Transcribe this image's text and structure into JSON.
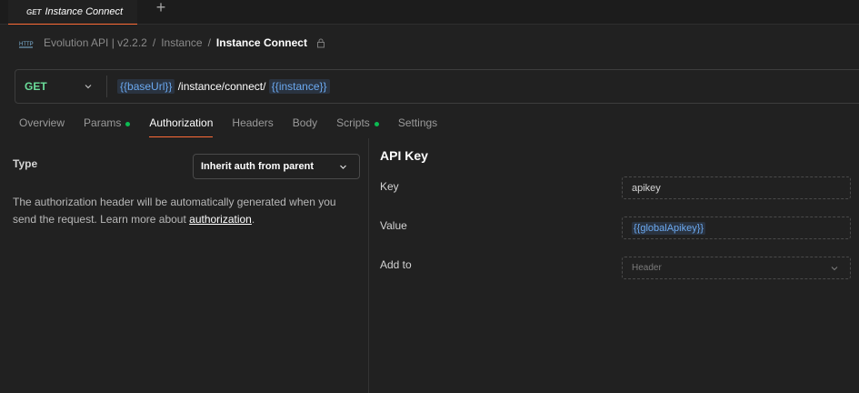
{
  "tab": {
    "method": "GET",
    "name": "Instance Connect",
    "new_tab": "+"
  },
  "breadcrumb": {
    "collection": "Evolution API | v2.2.2",
    "folder": "Instance",
    "separator": "/",
    "current": "Instance Connect"
  },
  "request": {
    "method": "GET",
    "url_var1": "{{baseUrl}}",
    "url_path": " /instance/connect/ ",
    "url_var2": "{{instance}}"
  },
  "tabs": [
    {
      "label": "Overview",
      "dot": false
    },
    {
      "label": "Params",
      "dot": true
    },
    {
      "label": "Authorization",
      "dot": false,
      "active": true
    },
    {
      "label": "Headers",
      "dot": false
    },
    {
      "label": "Body",
      "dot": false
    },
    {
      "label": "Scripts",
      "dot": true
    },
    {
      "label": "Settings",
      "dot": false
    }
  ],
  "auth": {
    "type_label": "Type",
    "type_value": "Inherit auth from parent",
    "description_pre": "The authorization header will be automatically generated when you send the request. Learn more about ",
    "description_link": "authorization",
    "description_post": "."
  },
  "apikey": {
    "title": "API Key",
    "key_label": "Key",
    "key_value": "apikey",
    "value_label": "Value",
    "value_value": "{{globalApikey}}",
    "addto_label": "Add to",
    "addto_value": "Header"
  },
  "colors": {
    "accent": "#ff6c37",
    "method_get": "#6bdd9a",
    "variable": "#6ba9f0",
    "status_dot": "#0cbb52"
  }
}
